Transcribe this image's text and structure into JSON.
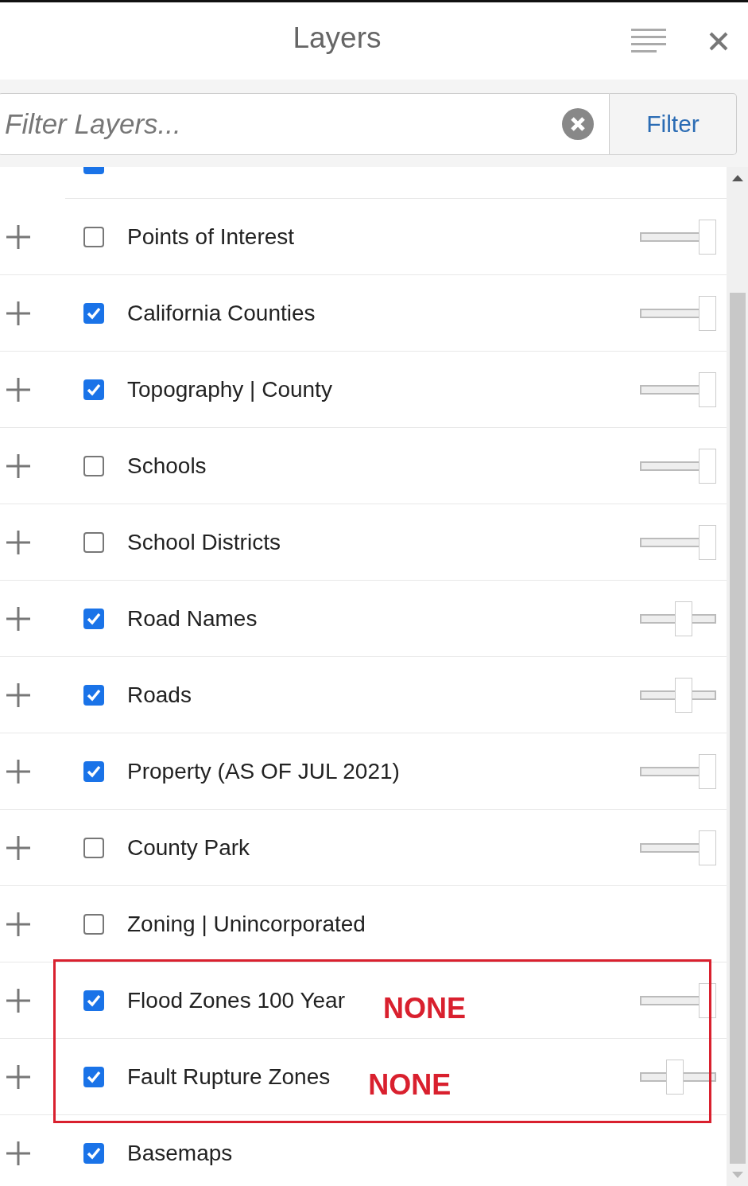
{
  "header": {
    "title": "Layers"
  },
  "filter": {
    "placeholder": "Filter Layers...",
    "button": "Filter"
  },
  "partial_row": {
    "checked": true
  },
  "layers": [
    {
      "name": "Points of Interest",
      "checked": false,
      "kind": "slider",
      "level": 1
    },
    {
      "name": "California Counties",
      "checked": true,
      "kind": "slider",
      "level": 1
    },
    {
      "name": "Topography | County",
      "checked": true,
      "kind": "slider",
      "level": 1
    },
    {
      "name": "Schools",
      "checked": false,
      "kind": "slider",
      "level": 1
    },
    {
      "name": "School Districts",
      "checked": false,
      "kind": "slider",
      "level": 1
    },
    {
      "name": "Road Names",
      "checked": true,
      "kind": "slider",
      "level": 0.6
    },
    {
      "name": "Roads",
      "checked": true,
      "kind": "slider",
      "level": 0.6
    },
    {
      "name": "Property (AS OF JUL 2021)",
      "checked": true,
      "kind": "slider",
      "level": 1
    },
    {
      "name": "County Park",
      "checked": false,
      "kind": "slider",
      "level": 1
    },
    {
      "name": "Zoning | Unincorporated",
      "checked": false,
      "kind": "plain"
    },
    {
      "name": "Flood Zones 100 Year",
      "checked": true,
      "kind": "slider",
      "level": 1,
      "note": "NONE",
      "highlighted": true
    },
    {
      "name": "Fault Rupture Zones",
      "checked": true,
      "kind": "slider",
      "level": 0.45,
      "note": "NONE",
      "highlighted": true
    },
    {
      "name": "Basemaps",
      "checked": true,
      "kind": "plain"
    }
  ]
}
